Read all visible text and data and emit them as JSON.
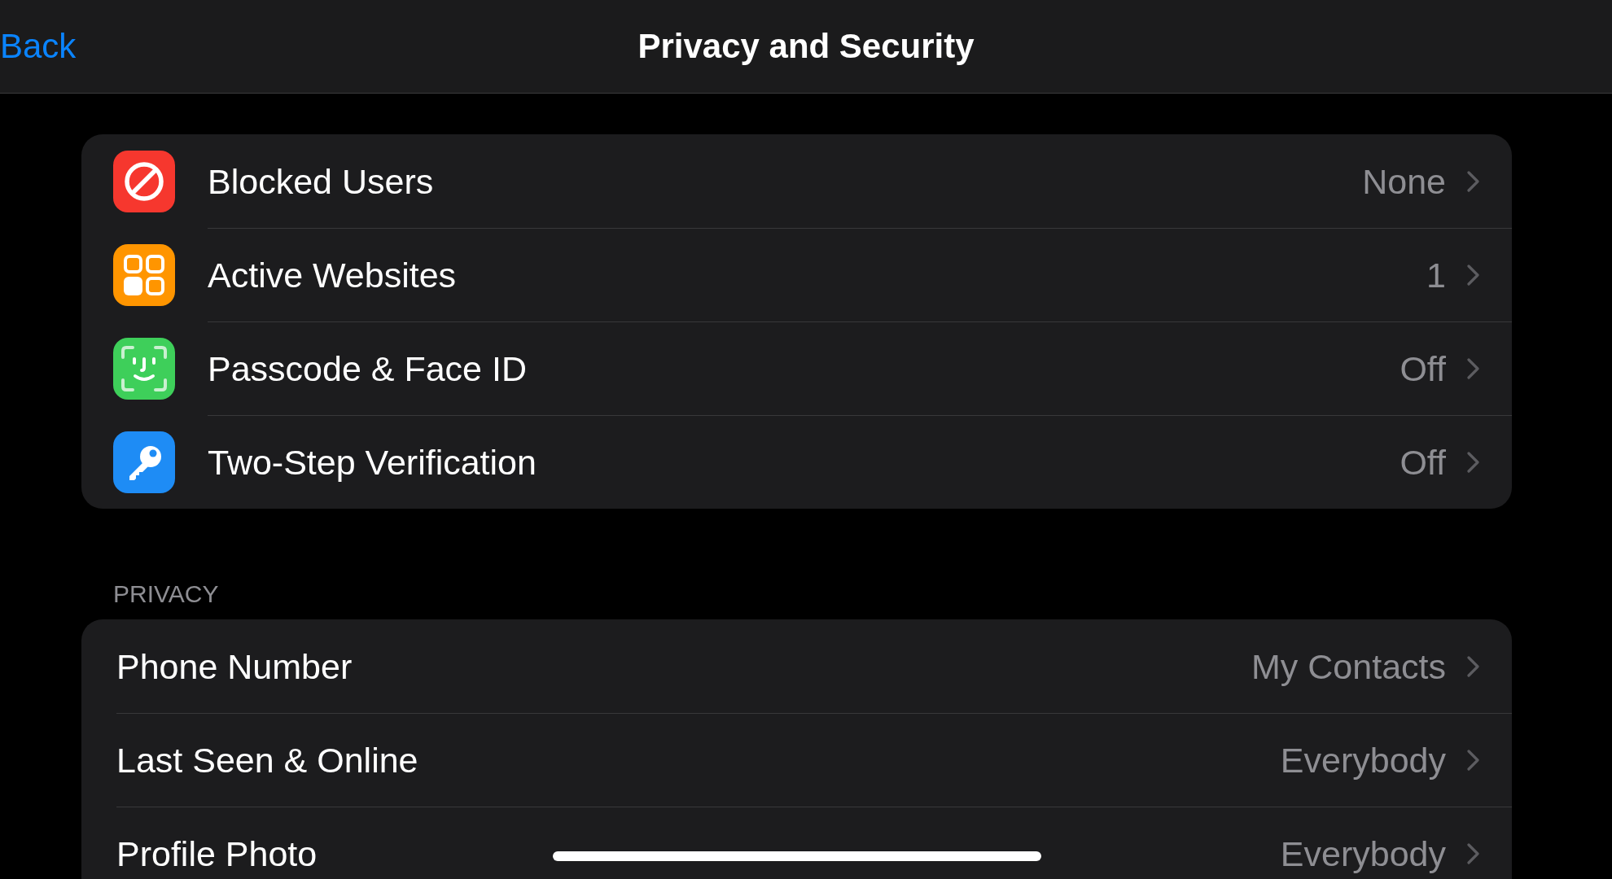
{
  "nav_bar": {
    "back": "Back",
    "title": "Privacy and Security"
  },
  "security_items": [
    {
      "kind": "block",
      "color": "#f6372e",
      "label": "Blocked Users",
      "value": "None"
    },
    {
      "kind": "sessions",
      "color": "#ff9500",
      "label": "Active Websites",
      "value": "1"
    },
    {
      "kind": "passcode",
      "color": "#3ecf5a",
      "label": "Passcode & Face ID",
      "value": "Off"
    },
    {
      "kind": "password",
      "color": "#1e8cf5",
      "label": "Two-Step Verification",
      "value": "Off"
    }
  ],
  "privacy": {
    "header": "PRIVACY",
    "items": [
      {
        "label": "Phone Number",
        "value": "My Contacts"
      },
      {
        "label": "Last Seen & Online",
        "value": "Everybody"
      },
      {
        "label": "Profile Photo",
        "value": "Everybody"
      }
    ]
  }
}
